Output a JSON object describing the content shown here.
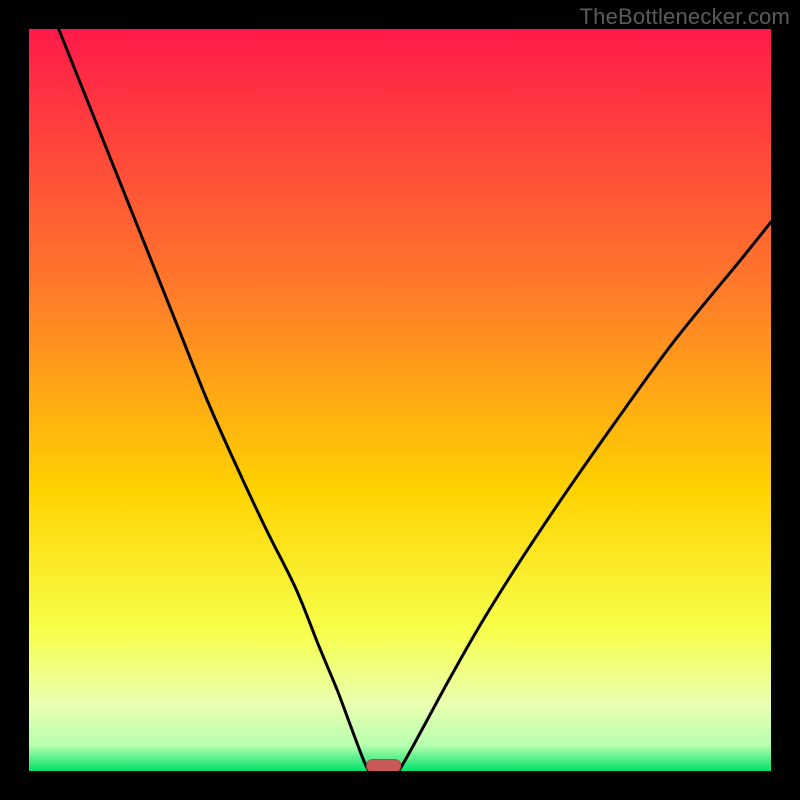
{
  "attribution": "TheBottlenecker.com",
  "colors": {
    "frame": "#000000",
    "gradient_top": "#ff1a49",
    "gradient_mid_upper": "#ff7a2a",
    "gradient_mid": "#ffd200",
    "gradient_lower": "#f5ff66",
    "gradient_green": "#00e268",
    "curve": "#000000",
    "marker_fill": "#c85a5a",
    "marker_stroke": "#b24848"
  },
  "chart_data": {
    "type": "line",
    "title": "",
    "xlabel": "",
    "ylabel": "",
    "xlim": [
      0,
      100
    ],
    "ylim": [
      0,
      100
    ],
    "series": [
      {
        "name": "bottleneck-curve-left",
        "x": [
          4,
          8,
          12,
          16,
          20,
          24,
          28,
          32,
          36,
          39,
          41.5,
          43,
          44.3,
          45.2,
          45.8
        ],
        "y": [
          100,
          90,
          80,
          70,
          60,
          50,
          41,
          32.5,
          24.5,
          17,
          11,
          7,
          3.5,
          1.2,
          0
        ]
      },
      {
        "name": "bottleneck-curve-right",
        "x": [
          49.8,
          50.6,
          52,
          54,
          57,
          61,
          66,
          72,
          79,
          87,
          96,
          100
        ],
        "y": [
          0,
          1.3,
          3.8,
          7.5,
          13,
          20,
          28,
          37,
          47,
          58,
          69,
          74
        ]
      }
    ],
    "marker": {
      "x_center": 47.8,
      "x_halfwidth": 2.3,
      "y": 0.7,
      "height": 1.7
    },
    "gradient_stops_percent": [
      {
        "offset": 0,
        "color": "#ff1a49"
      },
      {
        "offset": 35,
        "color": "#ff7a2a"
      },
      {
        "offset": 62,
        "color": "#ffd200"
      },
      {
        "offset": 81,
        "color": "#f7ff4a"
      },
      {
        "offset": 91,
        "color": "#eaffb0"
      },
      {
        "offset": 96.5,
        "color": "#b8ffb0"
      },
      {
        "offset": 100,
        "color": "#00e268"
      }
    ]
  }
}
